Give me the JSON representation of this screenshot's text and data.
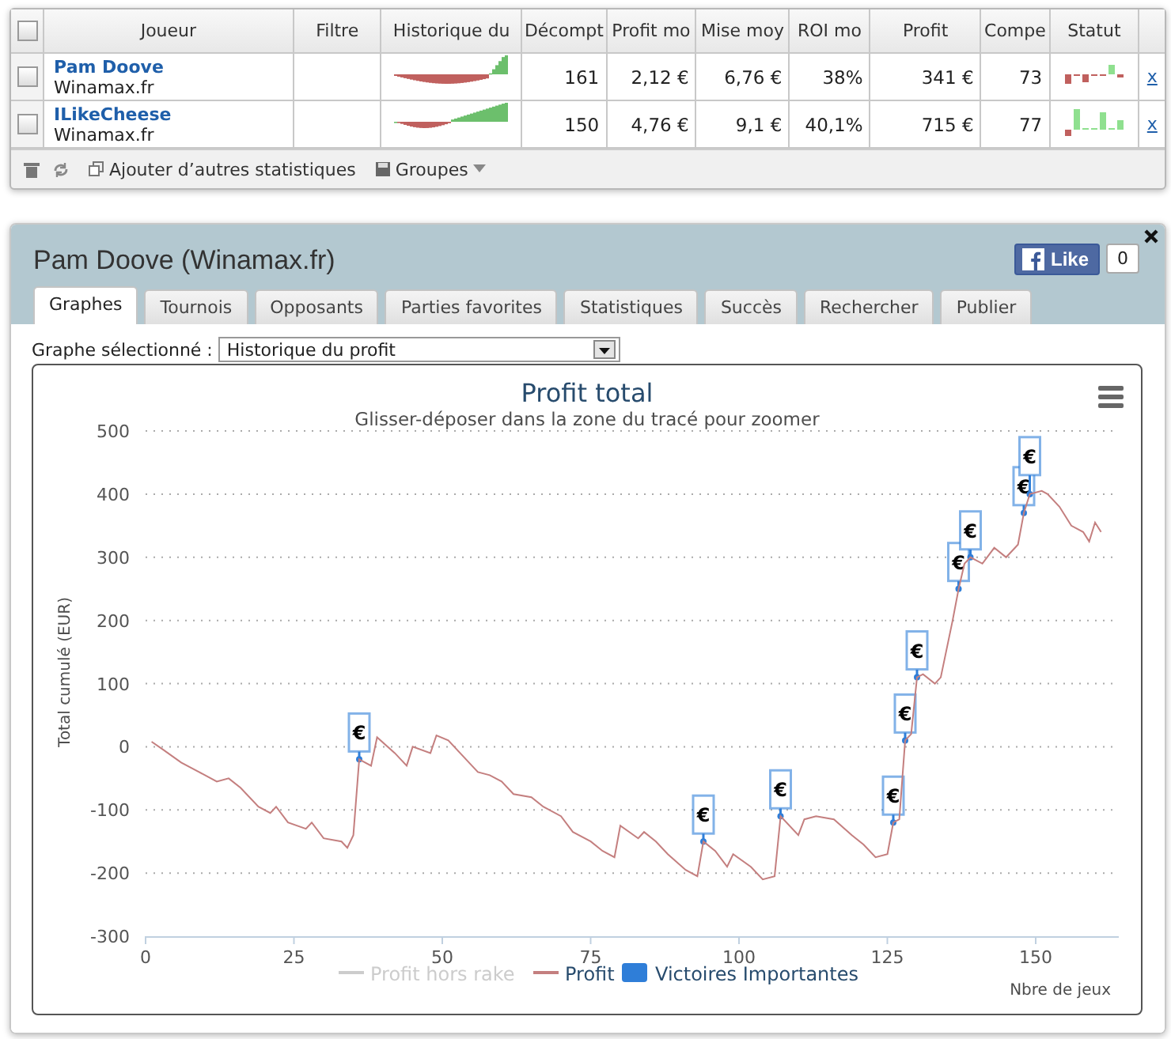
{
  "players_table": {
    "all_checked": false,
    "columns": [
      "Joueur",
      "Filtre",
      "Historique du",
      "Décompt",
      "Profit mo",
      "Mise moy",
      "ROI mo",
      "Profit",
      "Compe",
      "Statut"
    ],
    "rows": [
      {
        "checked": false,
        "name": "Pam Doove",
        "site": "Winamax.fr",
        "games": "161",
        "avg_profit": "2,12 €",
        "avg_stake": "6,76 €",
        "roi": "38%",
        "profit": "341 €",
        "compe": "73",
        "remove": "x"
      },
      {
        "checked": false,
        "name": "ILikeCheese",
        "site": "Winamax.fr",
        "games": "150",
        "avg_profit": "4,76 €",
        "avg_stake": "9,1 €",
        "roi": "40,1%",
        "profit": "715 €",
        "compe": "77",
        "remove": "x"
      }
    ],
    "toolbar": {
      "add_stats": "Ajouter d’autres statistiques",
      "groups": "Groupes"
    }
  },
  "panel": {
    "title": "Pam Doove (Winamax.fr)",
    "like_label": "Like",
    "like_count": "0",
    "tabs": [
      {
        "label": "Graphes",
        "selected": true
      },
      {
        "label": "Tournois",
        "selected": false
      },
      {
        "label": "Opposants",
        "selected": false
      },
      {
        "label": "Parties favorites",
        "selected": false
      },
      {
        "label": "Statistiques",
        "selected": false
      },
      {
        "label": "Succès",
        "selected": false
      },
      {
        "label": "Rechercher",
        "selected": false
      },
      {
        "label": "Publier",
        "selected": false
      }
    ],
    "graph_select": {
      "label": "Graphe sélectionné :",
      "value": "Historique du profit"
    },
    "chart": {
      "flag_label": "€",
      "hidden_legend": [
        {
          "label": "Profit hors rake",
          "visible": false
        }
      ],
      "chart_data": {
        "type": "line",
        "title": "Profit total",
        "subtitle": "Glisser-déposer dans la zone du tracé pour zoomer",
        "xlabel": "Nbre de jeux",
        "ylabel": "Total cumulé (EUR)",
        "grid": true,
        "legend": "bottom",
        "xlim": [
          0,
          164
        ],
        "ylim": [
          -300,
          500
        ],
        "xticks": [
          0,
          25,
          50,
          75,
          100,
          125,
          150
        ],
        "yticks": [
          -300,
          -200,
          -100,
          0,
          100,
          200,
          300,
          400,
          500
        ],
        "x": [
          1,
          3,
          6,
          9,
          12,
          14,
          16,
          19,
          21,
          22,
          24,
          27,
          28,
          30,
          33,
          34,
          35,
          36,
          38,
          39,
          42,
          44,
          45,
          48,
          49,
          51,
          54,
          56,
          58,
          60,
          62,
          65,
          67,
          70,
          72,
          75,
          77,
          79,
          80,
          83,
          84,
          86,
          88,
          91,
          93,
          94,
          96,
          98,
          99,
          102,
          104,
          106,
          107,
          110,
          111,
          113,
          116,
          119,
          121,
          123,
          125,
          126,
          127,
          128,
          129,
          130,
          131,
          133,
          134,
          136,
          137,
          138,
          139,
          141,
          143,
          145,
          147,
          148,
          149,
          151,
          152,
          154,
          156,
          158,
          159,
          160,
          161
        ],
        "series": [
          {
            "name": "Profit",
            "color": "#c47f7f",
            "values": [
              8,
              -5,
              -25,
              -40,
              -55,
              -50,
              -65,
              -95,
              -105,
              -95,
              -120,
              -130,
              -120,
              -145,
              -150,
              -160,
              -140,
              -20,
              -30,
              15,
              -10,
              -30,
              0,
              -10,
              18,
              10,
              -20,
              -40,
              -45,
              -55,
              -75,
              -80,
              -95,
              -110,
              -135,
              -150,
              -165,
              -175,
              -125,
              -145,
              -135,
              -150,
              -170,
              -195,
              -205,
              -150,
              -165,
              -190,
              -170,
              -190,
              -210,
              -205,
              -110,
              -140,
              -115,
              -110,
              -115,
              -140,
              -155,
              -175,
              -170,
              -120,
              -115,
              10,
              20,
              110,
              115,
              100,
              110,
              200,
              250,
              290,
              300,
              290,
              315,
              300,
              320,
              370,
              400,
              405,
              400,
              380,
              350,
              340,
              325,
              355,
              340
            ]
          },
          {
            "name": "Victoires Importantes",
            "type": "scatter",
            "color": "#2f7ed8",
            "values": [
              null,
              null,
              null,
              null,
              null,
              null,
              null,
              null,
              null,
              null,
              null,
              null,
              null,
              null,
              null,
              null,
              null,
              -20,
              null,
              null,
              null,
              null,
              null,
              null,
              null,
              null,
              null,
              null,
              null,
              null,
              null,
              null,
              null,
              null,
              null,
              null,
              null,
              null,
              null,
              null,
              null,
              null,
              null,
              null,
              null,
              -150,
              null,
              null,
              null,
              null,
              null,
              null,
              -110,
              null,
              null,
              null,
              null,
              null,
              null,
              null,
              null,
              -120,
              null,
              10,
              null,
              110,
              null,
              null,
              null,
              null,
              250,
              null,
              300,
              null,
              null,
              null,
              null,
              370,
              400,
              null,
              null,
              null,
              null,
              null,
              null,
              null,
              null
            ]
          }
        ]
      }
    }
  }
}
